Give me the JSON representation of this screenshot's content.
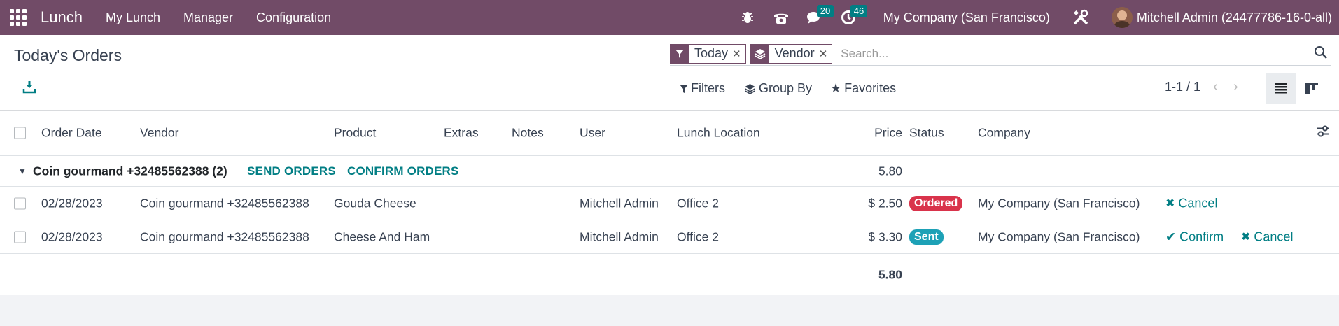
{
  "navbar": {
    "brand": "Lunch",
    "menu": [
      "My Lunch",
      "Manager",
      "Configuration"
    ],
    "messages_count": "20",
    "activities_count": "46",
    "company": "My Company (San Francisco)",
    "user": "Mitchell Admin (24477786-16-0-all)",
    "bg_color": "#714b67"
  },
  "page": {
    "title": "Today's Orders"
  },
  "search": {
    "facets": [
      {
        "label": "Today",
        "icon": "filter-icon"
      },
      {
        "label": "Vendor",
        "icon": "layers-icon"
      }
    ],
    "placeholder": "Search..."
  },
  "toolbar": {
    "filters": "Filters",
    "group_by": "Group By",
    "favorites": "Favorites",
    "pager": "1-1 / 1"
  },
  "table": {
    "columns": [
      "Order Date",
      "Vendor",
      "Product",
      "Extras",
      "Notes",
      "User",
      "Lunch Location",
      "Price",
      "Status",
      "Company"
    ],
    "group": {
      "title": "Coin gourmand +32485562388 (2)",
      "send_orders": "SEND ORDERS",
      "confirm_orders": "CONFIRM ORDERS",
      "total": "5.80"
    },
    "rows": [
      {
        "date": "02/28/2023",
        "vendor": "Coin gourmand +32485562388",
        "product": "Gouda Cheese",
        "user": "Mitchell Admin",
        "location": "Office 2",
        "price": "$ 2.50",
        "status": "Ordered",
        "status_color": "#d9334b",
        "company": "My Company (San Francisco)",
        "actions": [
          "Cancel"
        ]
      },
      {
        "date": "02/28/2023",
        "vendor": "Coin gourmand +32485562388",
        "product": "Cheese And Ham",
        "user": "Mitchell Admin",
        "location": "Office 2",
        "price": "$ 3.30",
        "status": "Sent",
        "status_color": "#1da1b6",
        "company": "My Company (San Francisco)",
        "actions": [
          "Confirm",
          "Cancel"
        ]
      }
    ],
    "grand_total": "5.80"
  }
}
